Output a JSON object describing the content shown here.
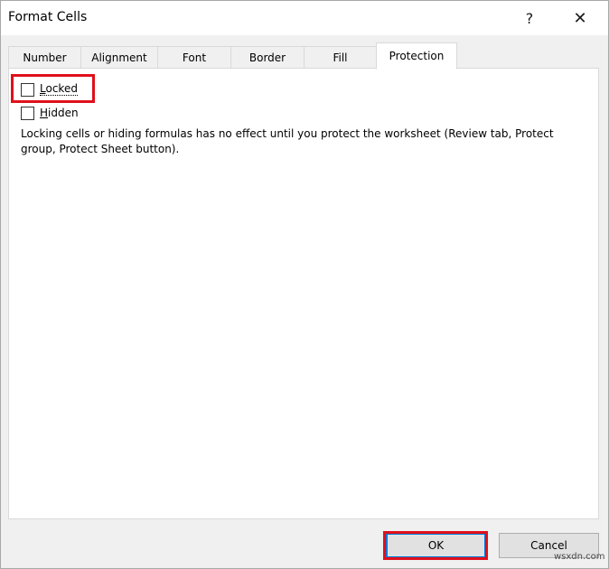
{
  "window": {
    "title": "Format Cells",
    "help_glyph": "?",
    "close_glyph": "✕"
  },
  "tabs": [
    {
      "label": "Number"
    },
    {
      "label": "Alignment"
    },
    {
      "label": "Font"
    },
    {
      "label": "Border"
    },
    {
      "label": "Fill"
    },
    {
      "label": "Protection",
      "active": true
    }
  ],
  "protection": {
    "locked": {
      "label_hotkey": "L",
      "label_rest": "ocked",
      "checked": false
    },
    "hidden": {
      "label_hotkey": "H",
      "label_rest": "idden",
      "checked": false
    },
    "info": "Locking cells or hiding formulas has no effect until you protect the worksheet (Review tab, Protect group, Protect Sheet button)."
  },
  "buttons": {
    "ok": "OK",
    "cancel": "Cancel"
  },
  "watermark": "wsxdn.com",
  "colors": {
    "highlight": "#e0101c",
    "dialog_bg": "#f0f0f0",
    "panel_bg": "#ffffff"
  }
}
